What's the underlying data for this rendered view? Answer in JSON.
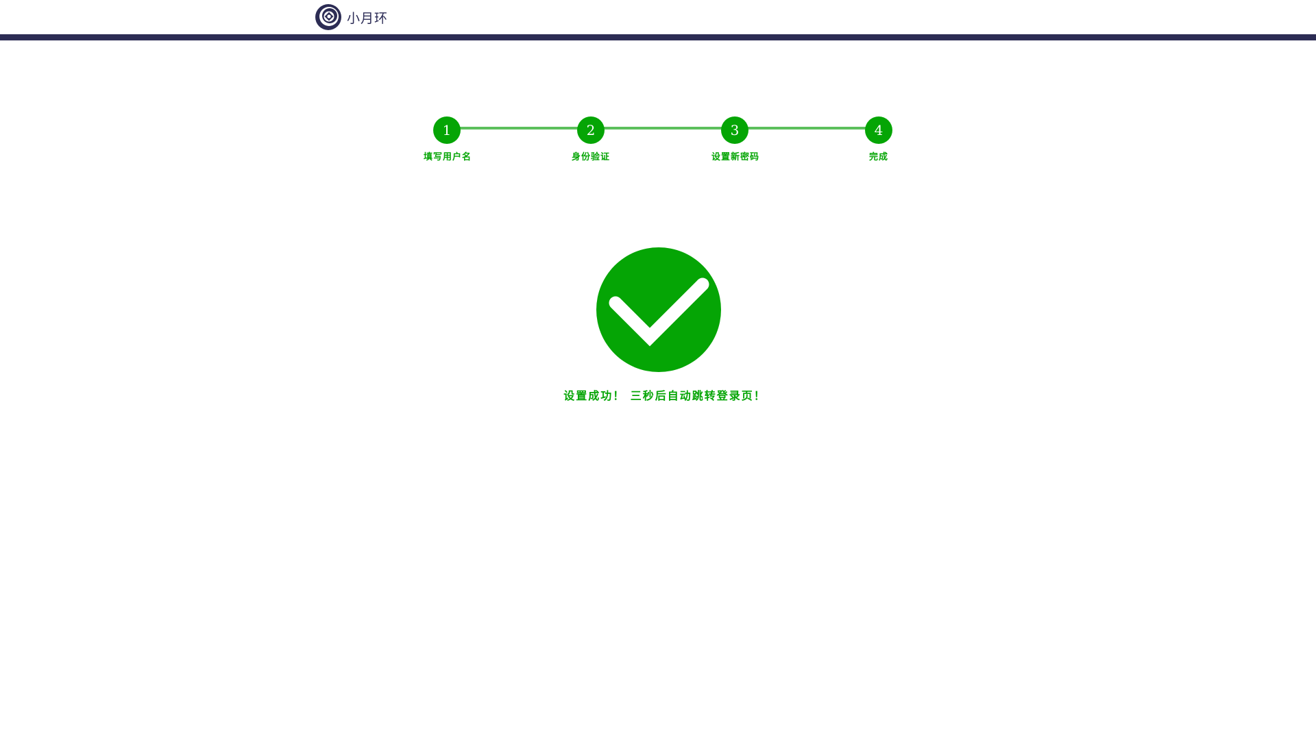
{
  "header": {
    "brand_name": "小月环",
    "logo_icon": "ring-target-logo-icon"
  },
  "steps": [
    {
      "number": "1",
      "label": "填写用户名",
      "state": "done"
    },
    {
      "number": "2",
      "label": "身份验证",
      "state": "done"
    },
    {
      "number": "3",
      "label": "设置新密码",
      "state": "done"
    },
    {
      "number": "4",
      "label": "完成",
      "state": "done"
    }
  ],
  "result": {
    "icon": "check-circle-icon",
    "message": "设置成功！ 三秒后自动跳转登录页！"
  },
  "colors": {
    "header_bar": "#2c2c54",
    "brand_text": "#2b2b55",
    "success": "#05a505",
    "step_line": "#5cbf5c"
  }
}
